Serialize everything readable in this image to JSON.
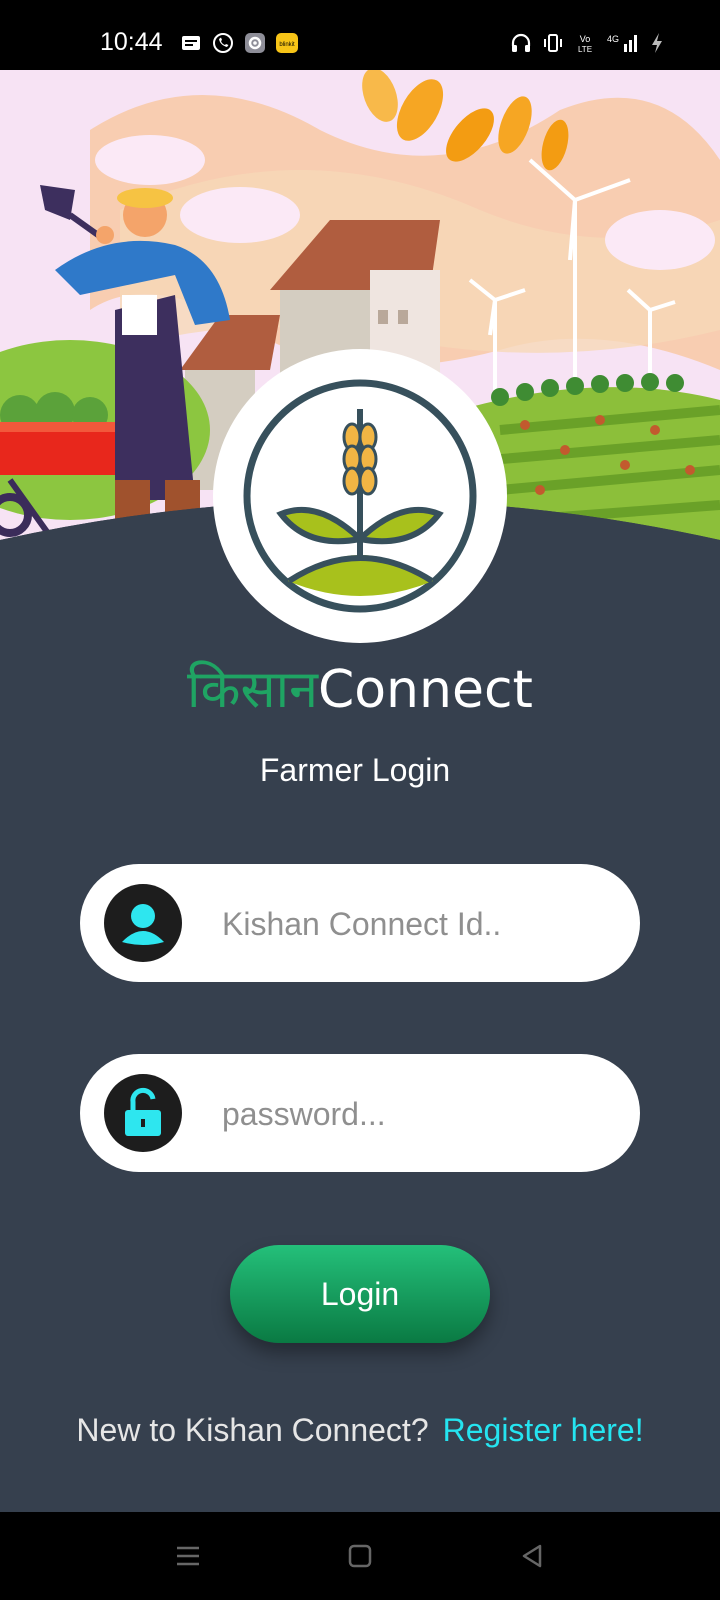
{
  "status_bar": {
    "time": "10:44",
    "left_icons": [
      "message-icon",
      "whatsapp-icon",
      "settings-app-icon",
      "blinkit-icon"
    ],
    "blinkit_label": "blinkit",
    "right_icons": [
      "headphones-icon",
      "vibrate-icon",
      "volte-icon",
      "signal-4g-icon",
      "charging-icon"
    ],
    "network_label": "4G"
  },
  "brand": {
    "hindi": "किसान",
    "english": "Connect"
  },
  "subtitle": "Farmer Login",
  "form": {
    "id_placeholder": "Kishan Connect Id..",
    "id_value": "",
    "password_placeholder": "password...",
    "password_value": ""
  },
  "login_label": "Login",
  "register": {
    "question": "New to Kishan Connect?",
    "link": "Register here!"
  },
  "nav": [
    "menu-icon",
    "home-icon",
    "back-icon"
  ],
  "colors": {
    "panel": "#36404e",
    "accent_green": "#1fa463",
    "icon_cyan": "#2ee6ef",
    "link_cyan": "#25e4f0"
  }
}
